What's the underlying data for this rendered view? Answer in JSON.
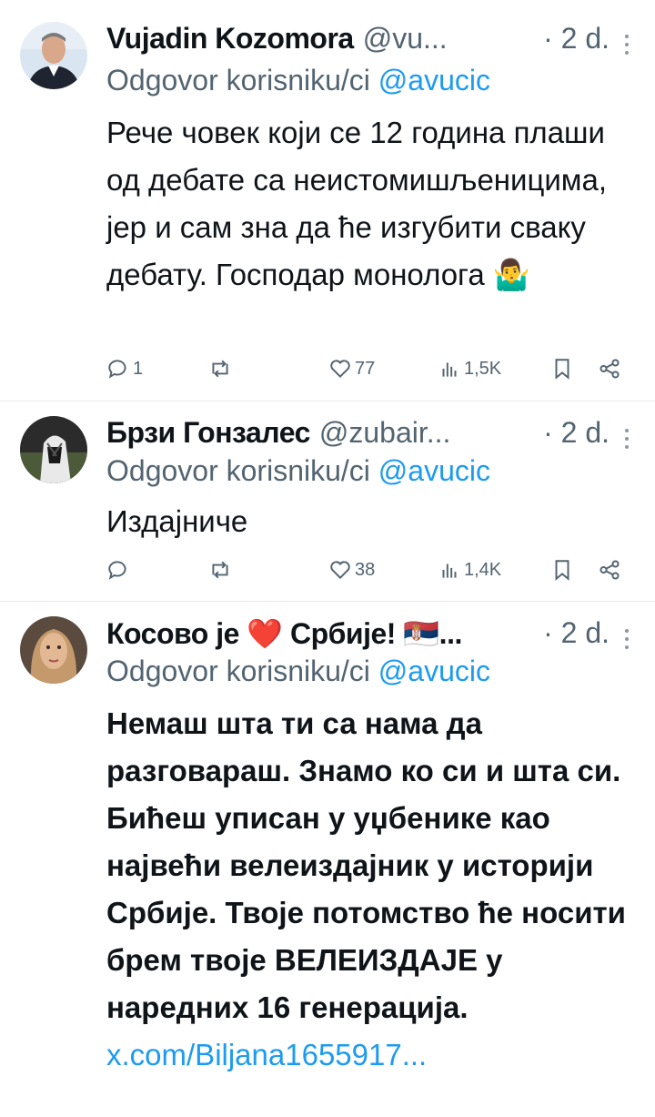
{
  "tweets": [
    {
      "name": "Vujadin Kozomora",
      "handle": "@vu...",
      "time": "· 2 d.",
      "reply_prefix": "Odgovor korisniku/ci",
      "reply_mention": "@avucic",
      "text": "Рече човек који се 12 година плаши од дебате са неистомишљеницима, јер и сам зна да ће изгубити сваку дебату. Господар монолога 🤷‍♂️",
      "replies": "1",
      "retweets": "",
      "likes": "77",
      "views": "1,5K",
      "avatar_color": "#7d8fa3"
    },
    {
      "name": "Брзи Гонзалес",
      "handle": "@zubair...",
      "time": "· 2 d.",
      "reply_prefix": "Odgovor korisniku/ci",
      "reply_mention": "@avucic",
      "text": "Издајниче",
      "replies": "",
      "retweets": "",
      "likes": "38",
      "views": "1,4K",
      "avatar_color": "#4a4a4a"
    },
    {
      "name": "Косово је ❤️ Србије! 🇷🇸...",
      "handle": "",
      "time": "· 2 d.",
      "reply_prefix": "Odgovor korisniku/ci",
      "reply_mention": "@avucic",
      "text": "Немаш шта ти са нама да разговараш. Знамо ко си и шта си. Бићеш уписан у уџбенике као највећи велеиздајник у историји Србије. Твоје потомство ће носити брем твоје ВЕЛЕИЗДАЈЕ у наредних 16 генерација.",
      "link": "x.com/Biljana1655917...",
      "avatar_color": "#b88a6e"
    }
  ],
  "icons": {
    "reply": "reply-icon",
    "retweet": "retweet-icon",
    "like": "heart-icon",
    "views": "views-icon",
    "bookmark": "bookmark-icon",
    "share": "share-icon",
    "more": "more-icon"
  },
  "colors": {
    "link": "#1d9bf0",
    "secondary": "#536471"
  }
}
